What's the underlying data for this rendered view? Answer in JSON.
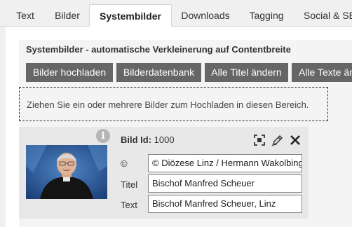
{
  "tabs": [
    {
      "label": "Text",
      "active": false
    },
    {
      "label": "Bilder",
      "active": false
    },
    {
      "label": "Systembilder",
      "active": true
    },
    {
      "label": "Downloads",
      "active": false
    },
    {
      "label": "Tagging",
      "active": false
    },
    {
      "label": "Social & SEO",
      "active": false
    }
  ],
  "section": {
    "title": "Systembilder - automatische Verkleinerung auf Contentbreite"
  },
  "buttons": [
    {
      "label": "Bilder hochladen"
    },
    {
      "label": "Bilderdatenbank"
    },
    {
      "label": "Alle Titel ändern"
    },
    {
      "label": "Alle Texte ändern"
    }
  ],
  "dropzone": {
    "text": "Ziehen Sie ein oder mehrere Bilder zum Hochladen in diesen Bereich."
  },
  "image": {
    "id_label": "Bild Id:",
    "id_value": "1000",
    "copyright_label": "©",
    "copyright_value": "© Diözese Linz / Hermann Wakolbinger",
    "title_label": "Titel",
    "title_value": "Bischof Manfred Scheuer",
    "text_label": "Text",
    "text_value": "Bischof Manfred Scheuer, Linz"
  },
  "icons": {
    "info": "info-icon",
    "crop": "crop-icon",
    "edit": "pencil-icon",
    "delete": "close-icon"
  },
  "colors": {
    "button_bg": "#666666",
    "active_tab_bg": "#ffffff",
    "card_bg": "#e8e8e8"
  }
}
